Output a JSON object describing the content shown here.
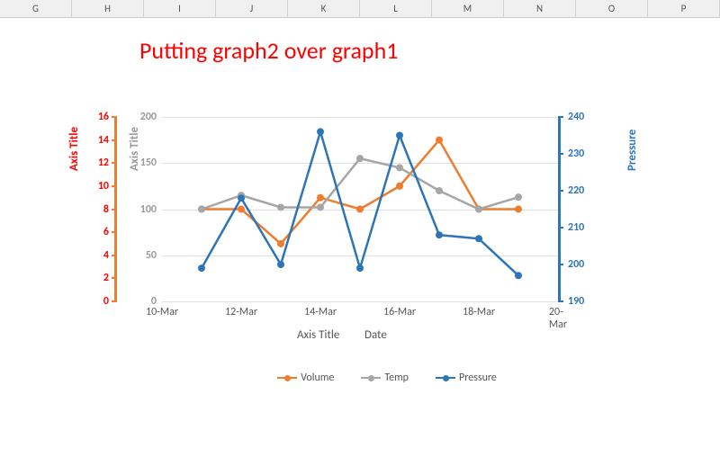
{
  "columns": [
    "G",
    "H",
    "I",
    "J",
    "K",
    "L",
    "M",
    "N",
    "O",
    "P"
  ],
  "title": "Putting graph2 over graph1",
  "axes": {
    "red_title": "Axis Title",
    "gray_title": "Axis Title",
    "blue_title": "Pressure",
    "x_title1": "Axis Title",
    "x_title2": "Date"
  },
  "legend": {
    "volume": "Volume",
    "temp": "Temp",
    "pressure": "Pressure"
  },
  "chart_data": {
    "type": "line",
    "x": [
      "11-Mar",
      "12-Mar",
      "13-Mar",
      "14-Mar",
      "15-Mar",
      "16-Mar",
      "17-Mar",
      "18-Mar",
      "19-Mar"
    ],
    "x_ticks": [
      "10-Mar",
      "12-Mar",
      "14-Mar",
      "16-Mar",
      "18-Mar",
      "20-Mar"
    ],
    "series": [
      {
        "name": "Volume",
        "axis": "left_red",
        "color": "#ed7d31",
        "values": [
          8,
          8,
          5,
          9,
          8,
          10,
          14,
          8,
          8
        ]
      },
      {
        "name": "Temp",
        "axis": "left_gray",
        "color": "#a6a6a6",
        "values": [
          100,
          115,
          102,
          102,
          155,
          145,
          120,
          100,
          113
        ]
      },
      {
        "name": "Pressure",
        "axis": "right_blue",
        "color": "#2e75b6",
        "values": [
          199,
          218,
          200,
          236,
          199,
          235,
          208,
          207,
          197
        ]
      }
    ],
    "y_left_red": {
      "label": "Axis Title",
      "min": 0,
      "max": 16,
      "ticks": [
        0,
        2,
        4,
        6,
        8,
        10,
        12,
        14,
        16
      ]
    },
    "y_left_gray": {
      "label": "Axis Title",
      "min": 0,
      "max": 200,
      "ticks": [
        0,
        50,
        100,
        150,
        200
      ]
    },
    "y_right_blue": {
      "label": "Pressure",
      "min": 190,
      "max": 240,
      "ticks": [
        190,
        200,
        210,
        220,
        230,
        240
      ]
    }
  }
}
